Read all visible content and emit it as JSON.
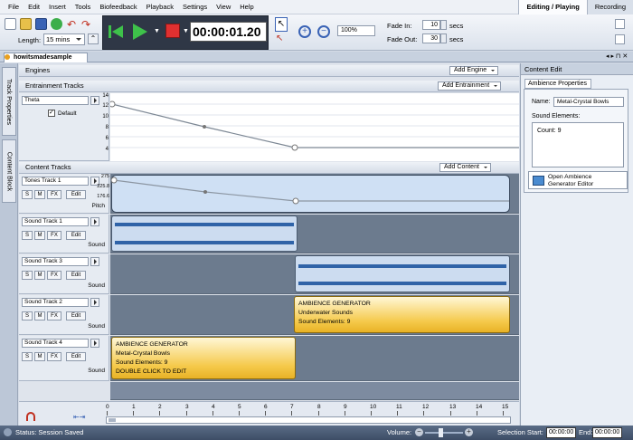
{
  "menu": [
    "File",
    "Edit",
    "Insert",
    "Tools",
    "Biofeedback",
    "Playback",
    "Settings",
    "View",
    "Help"
  ],
  "mode_tabs": [
    "Editing / Playing",
    "Recording"
  ],
  "toolbar": {
    "length_label": "Length:",
    "length_value": "15 mins",
    "timecode": "00:00:01.20",
    "zoom": "100%",
    "fade_in_label": "Fade In:",
    "fade_in_value": "10",
    "fade_out_label": "Fade Out:",
    "fade_out_value": "30",
    "secs": "secs"
  },
  "doc_tab": "howitsmadesample",
  "left_tabs": [
    "Track Properties",
    "Content Block"
  ],
  "engines": {
    "label": "Engines",
    "button": "Add Engine"
  },
  "entrainment": {
    "label": "Entrainment Tracks",
    "button": "Add Entrainment",
    "track_name": "Theta",
    "default_label": "Default",
    "y_ticks": [
      "14",
      "12",
      "10",
      "8",
      "6",
      "4"
    ]
  },
  "content": {
    "label": "Content Tracks",
    "button": "Add Content"
  },
  "tracks": [
    {
      "name": "Tones Track 1",
      "footer": "Pitch",
      "yticks": [
        "275",
        "225.8",
        "176.6"
      ]
    },
    {
      "name": "Sound Track 1",
      "footer": "Sound"
    },
    {
      "name": "Sound Track 3",
      "footer": "Sound"
    },
    {
      "name": "Sound Track 2",
      "footer": "Sound"
    },
    {
      "name": "Sound Track 4",
      "footer": "Sound"
    }
  ],
  "btns": {
    "s": "S",
    "m": "M",
    "fx": "FX",
    "edit": "Edit"
  },
  "amb_blocks": [
    {
      "title": "AMBIENCE GENERATOR",
      "line1": "Underwater Sounds",
      "line2": "Sound Elements: 9",
      "line3": ""
    },
    {
      "title": "AMBIENCE GENERATOR",
      "line1": "Metal-Crystal Bowls",
      "line2": "Sound Elements: 9",
      "line3": "DOUBLE CLICK TO EDIT"
    }
  ],
  "ruler": [
    "0",
    "1",
    "2",
    "3",
    "4",
    "5",
    "6",
    "7",
    "8",
    "9",
    "10",
    "11",
    "12",
    "13",
    "14",
    "15"
  ],
  "right": {
    "header": "Content Edit",
    "tab": "Ambience Properties",
    "name_label": "Name:",
    "name_value": "Metal-Crystal Bowls",
    "elements_label": "Sound Elements:",
    "count": "Count: 9",
    "open_btn_line1": "Open Ambience",
    "open_btn_line2": "Generator Editor"
  },
  "status": {
    "text": "Status: Session Saved",
    "volume_label": "Volume:",
    "sel_start_label": "Selection Start:",
    "sel_start_value": "00:00:00",
    "end_label": "End:",
    "end_value": "00:00:00"
  }
}
